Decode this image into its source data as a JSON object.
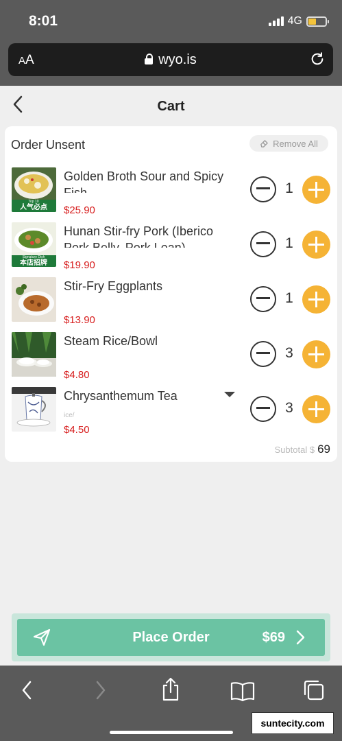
{
  "status_bar": {
    "time": "8:01",
    "network": "4G"
  },
  "browser": {
    "text_size_label_small": "A",
    "text_size_label_large": "A",
    "url": "wyo.is"
  },
  "header": {
    "title": "Cart"
  },
  "cart": {
    "order_status": "Order Unsent",
    "remove_all_label": "Remove All",
    "items": [
      {
        "name": "Golden Broth Sour and Spicy Fish",
        "price": "$25.90",
        "qty": "1",
        "note": ""
      },
      {
        "name": "Hunan Stir-fry Pork (Iberico Pork Belly, Pork Loan)",
        "price": "$19.90",
        "qty": "1",
        "note": ""
      },
      {
        "name": "Stir-Fry Eggplants",
        "price": "$13.90",
        "qty": "1",
        "note": ""
      },
      {
        "name": "Steam Rice/Bowl",
        "price": "$4.80",
        "qty": "3",
        "note": ""
      },
      {
        "name": "Chrysanthemum Tea",
        "price": "$4.50",
        "qty": "3",
        "note": "ice/"
      }
    ],
    "image_badges": {
      "item0": "人气必点",
      "item0_top": "Top 10",
      "item1": "本店招牌",
      "item1_top": "Signature Dish"
    },
    "subtotal_label": "Subtotal $",
    "subtotal_value": "69"
  },
  "place_order": {
    "label": "Place Order",
    "total": "$69"
  },
  "watermark": "suntecity.com",
  "colors": {
    "accent_green": "#6bc3a3",
    "plus_orange": "#f5b335",
    "price_red": "#d71d1d"
  }
}
